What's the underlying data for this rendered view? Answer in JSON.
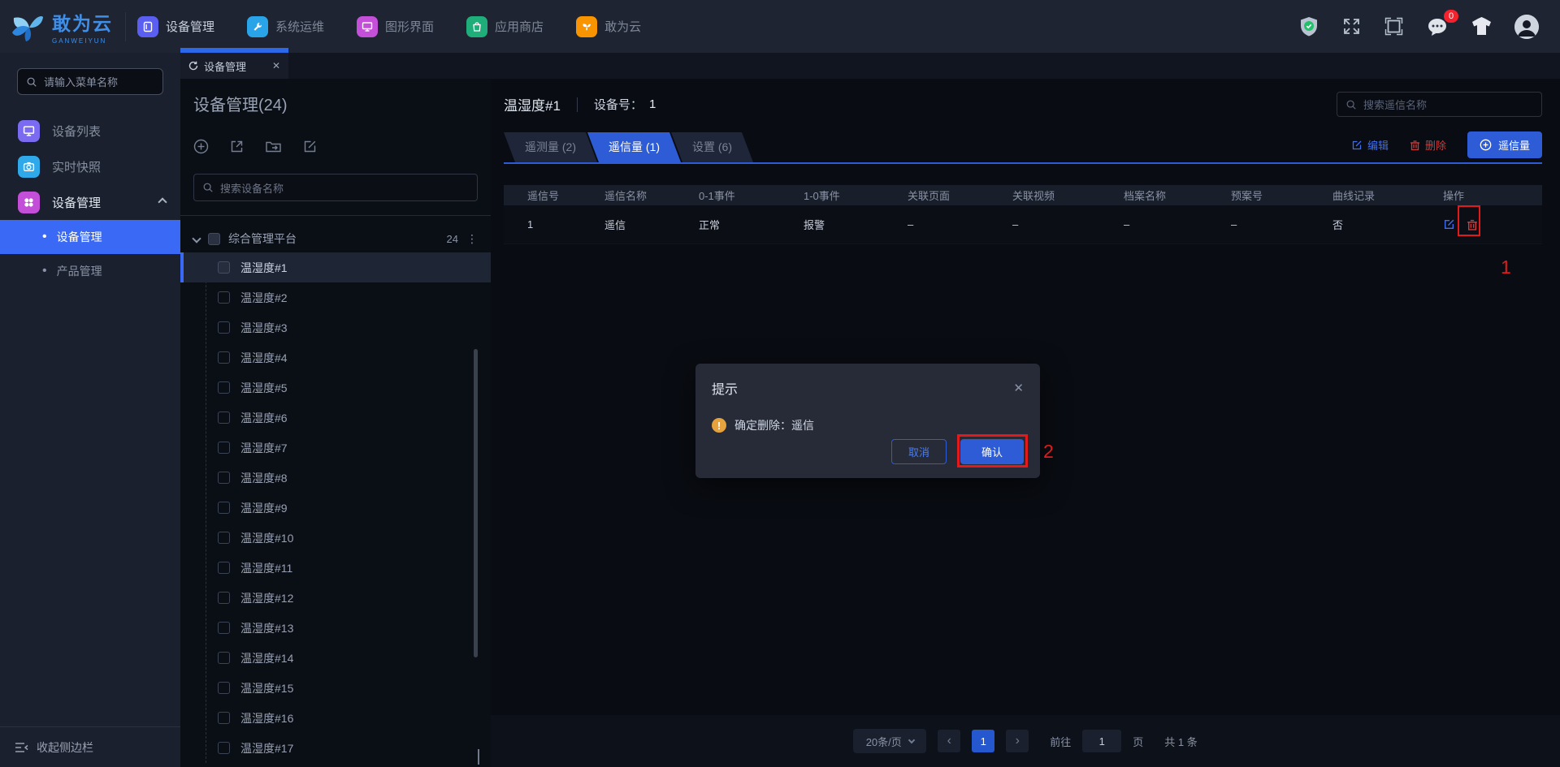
{
  "colors": {
    "accent": "#2d5cd6",
    "sidebar_active": "#3a6af5",
    "danger": "#cf3a3a",
    "warning": "#e6a23c",
    "success": "#21c06a",
    "badge": "#f5222d",
    "annotation": "#e11b1b",
    "brand_blue": "#3f8fe8",
    "nav_device": "#5a5ff2",
    "nav_ops": "#2aa4e9",
    "nav_gui": "#c44fd8",
    "nav_store": "#1fae7a",
    "nav_gwy": "#f79400"
  },
  "topbar": {
    "brand": {
      "name": "敢为云",
      "sub": "GANWEIYUN"
    },
    "nav": [
      {
        "label": "设备管理",
        "active": true
      },
      {
        "label": "系统运维"
      },
      {
        "label": "图形界面"
      },
      {
        "label": "应用商店"
      },
      {
        "label": "敢为云"
      }
    ],
    "message_badge": "0"
  },
  "tabstrip": {
    "tab_label": "设备管理",
    "close": "✕"
  },
  "sidebar": {
    "search_placeholder": "请输入菜单名称",
    "items": [
      {
        "label": "设备列表"
      },
      {
        "label": "实时快照"
      },
      {
        "label": "设备管理",
        "expanded": true
      }
    ],
    "subitems": [
      {
        "label": "设备管理",
        "active": true,
        "bullet": "•"
      },
      {
        "label": "产品管理",
        "bullet": "•"
      }
    ],
    "collapse_label": "收起侧边栏"
  },
  "device_panel": {
    "title": "设备管理(24)",
    "search_placeholder": "搜索设备名称",
    "root": {
      "label": "综合管理平台",
      "count": "24",
      "kebab": "⋮"
    },
    "children": [
      {
        "label": "温湿度#1",
        "selected": true
      },
      {
        "label": "温湿度#2"
      },
      {
        "label": "温湿度#3"
      },
      {
        "label": "温湿度#4"
      },
      {
        "label": "温湿度#5"
      },
      {
        "label": "温湿度#6"
      },
      {
        "label": "温湿度#7"
      },
      {
        "label": "温湿度#8"
      },
      {
        "label": "温湿度#9"
      },
      {
        "label": "温湿度#10"
      },
      {
        "label": "温湿度#11"
      },
      {
        "label": "温湿度#12"
      },
      {
        "label": "温湿度#13"
      },
      {
        "label": "温湿度#14"
      },
      {
        "label": "温湿度#15"
      },
      {
        "label": "温湿度#16"
      },
      {
        "label": "温湿度#17"
      }
    ]
  },
  "main": {
    "device_name": "温湿度#1",
    "device_no_label": "设备号：",
    "device_no_value": "1",
    "search_placeholder": "搜索遥信名称",
    "tabs": [
      {
        "label": "遥测量 (2)"
      },
      {
        "label": "遥信量 (1)",
        "active": true
      },
      {
        "label": "设置 (6)"
      }
    ],
    "actions": {
      "edit": "编辑",
      "delete": "删除",
      "add": "遥信量"
    },
    "table": {
      "headers": [
        "遥信号",
        "遥信名称",
        "0-1事件",
        "1-0事件",
        "关联页面",
        "关联视频",
        "档案名称",
        "预案号",
        "曲线记录",
        "操作"
      ],
      "rows": [
        {
          "cells": [
            "1",
            "遥信",
            "正常",
            "报警",
            "–",
            "–",
            "–",
            "–",
            "否"
          ]
        }
      ]
    },
    "pagination": {
      "size": "20条/页",
      "prev": "‹",
      "page": "1",
      "next": "›",
      "goto_label": "前往",
      "goto_value": "1",
      "page_label": "页",
      "total": "共 1 条"
    }
  },
  "modal": {
    "title": "提示",
    "close": "✕",
    "message": "确定删除：遥信",
    "cancel": "取消",
    "confirm": "确认"
  },
  "annotations": {
    "step1": "1",
    "step2": "2"
  }
}
